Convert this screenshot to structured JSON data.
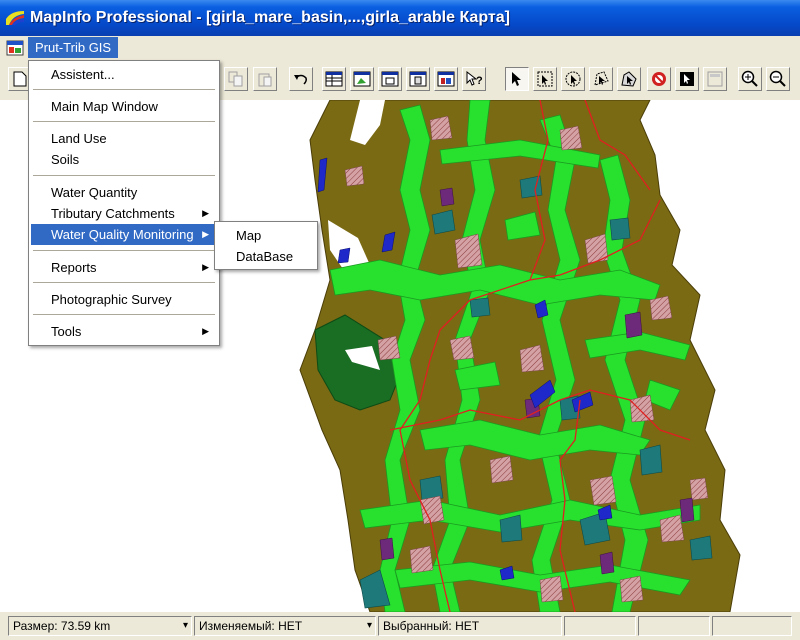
{
  "window": {
    "title": "MapInfo Professional - [girla_mare_basin,...,girla_arable Карта]"
  },
  "menubar": {
    "active_menu": "Prut-Trib GIS"
  },
  "dropdown": {
    "items": [
      {
        "label": "Assistent...",
        "submenu": false
      },
      {
        "label": "Main Map Window",
        "submenu": false
      },
      {
        "label": "Land Use",
        "submenu": false
      },
      {
        "label": "Soils",
        "submenu": false
      },
      {
        "label": "Water Quantity",
        "submenu": false
      },
      {
        "label": "Tributary Catchments",
        "submenu": true
      },
      {
        "label": "Water Quality Monitoring",
        "submenu": true,
        "highlighted": true
      },
      {
        "label": "Reports",
        "submenu": true
      },
      {
        "label": "Photographic Survey",
        "submenu": false
      },
      {
        "label": "Tools",
        "submenu": true
      }
    ]
  },
  "submenu": {
    "items": [
      "Map",
      "DataBase"
    ]
  },
  "statusbar": {
    "size": "Размер: 73.59 km",
    "editable": "Изменяемый: НЕТ",
    "selected": "Выбранный: НЕТ"
  },
  "colors": {
    "titlebar": "#0548c8",
    "menu_highlight": "#316ac5",
    "map_base": "#7a6a13",
    "map_green": "#28e02e",
    "map_dark_green": "#196e23",
    "map_teal": "#1e7a7a",
    "map_pink": "#d4a1a4",
    "map_purple": "#6e2a7a",
    "map_blue": "#1f28c8",
    "boundary": "#e02020"
  },
  "toolbar": {
    "icons": [
      "new-icon",
      "copy-icon",
      "paste-icon",
      "undo-icon",
      "browser-icon",
      "map-icon",
      "graph-icon",
      "layout-icon",
      "redistrict-icon",
      "help-icon",
      "select-icon",
      "marquee-select-icon",
      "radius-select-icon",
      "polygon-select-icon",
      "boundary-select-icon",
      "unselect-icon",
      "invert-select-icon",
      "graph-select-icon",
      "zoom-in-icon",
      "zoom-out-icon"
    ]
  }
}
